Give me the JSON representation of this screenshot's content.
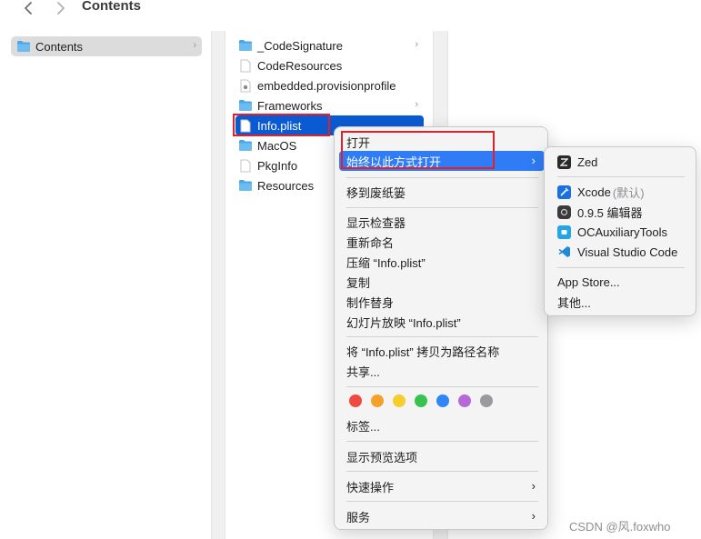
{
  "toolbar": {
    "title": "Contents"
  },
  "sidebar": {
    "selected_folder": "Contents"
  },
  "files": [
    {
      "name": "_CodeSignature",
      "kind": "folder",
      "has_children": true
    },
    {
      "name": "CodeResources",
      "kind": "file",
      "has_children": false
    },
    {
      "name": "embedded.provisionprofile",
      "kind": "profile",
      "has_children": false
    },
    {
      "name": "Frameworks",
      "kind": "folder",
      "has_children": true
    },
    {
      "name": "Info.plist",
      "kind": "file",
      "has_children": false,
      "selected": true
    },
    {
      "name": "MacOS",
      "kind": "folder",
      "has_children": false
    },
    {
      "name": "PkgInfo",
      "kind": "file",
      "has_children": false
    },
    {
      "name": "Resources",
      "kind": "folder",
      "has_children": false
    }
  ],
  "context_menu": {
    "open": "打开",
    "always_open_with": "始终以此方式打开",
    "move_to_trash": "移到废纸篓",
    "get_info": "显示检查器",
    "rename": "重新命名",
    "compress": "压缩 “Info.plist”",
    "duplicate": "复制",
    "make_alias": "制作替身",
    "slideshow": "幻灯片放映 “Info.plist”",
    "copy_as_pathname": "将 “Info.plist” 拷贝为路径名称",
    "share": "共享...",
    "tags_label": "标签...",
    "show_view_options": "显示预览选项",
    "quick_actions": "快速操作",
    "services": "服务",
    "tag_colors": [
      "#ee4b3f",
      "#f6a02c",
      "#f5cd2d",
      "#38c24f",
      "#2f86f6",
      "#b66ad8",
      "#9a9a9e"
    ]
  },
  "submenu": {
    "default_app": "Zed",
    "apps": [
      {
        "name": "Xcode",
        "note": "(默认)",
        "icon": "xcode-icon"
      },
      {
        "name": "0.9.5 编辑器",
        "note": "",
        "icon": "editor-icon"
      },
      {
        "name": "OCAuxiliaryTools",
        "note": "",
        "icon": "ocat-icon"
      },
      {
        "name": "Visual Studio Code",
        "note": "",
        "icon": "vscode-icon"
      }
    ],
    "app_store": "App Store...",
    "other": "其他..."
  },
  "watermark": "CSDN @风.foxwho"
}
